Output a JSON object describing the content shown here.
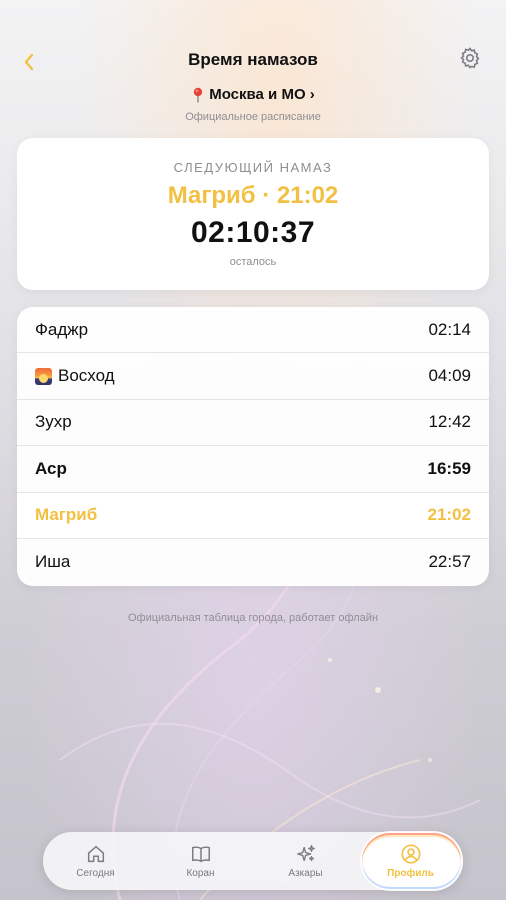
{
  "header": {
    "title": "Время намазов",
    "back_icon": "chevron-left-icon",
    "settings_icon": "gear-icon",
    "city": "Москва и МО ›",
    "subtitle": "Официальное расписание"
  },
  "next_prayer": {
    "label": "СЛЕДУЮЩИЙ НАМАЗ",
    "name_time": "Магриб · 21:02",
    "countdown": "02:10:37",
    "remaining_label": "осталось"
  },
  "prayer_times": [
    {
      "name": "Фаджр",
      "time": "02:14"
    },
    {
      "name": "Восход",
      "time": "04:09"
    },
    {
      "name": "Зухр",
      "time": "12:42"
    },
    {
      "name": "Аср",
      "time": "16:59"
    },
    {
      "name": "Магриб",
      "time": "21:02"
    },
    {
      "name": "Иша",
      "time": "22:57"
    }
  ],
  "footnote": "Официальная таблица города, работает офлайн",
  "tabs": [
    {
      "label": "Сегодня",
      "icon": "home-icon"
    },
    {
      "label": "Коран",
      "icon": "book-icon"
    },
    {
      "label": "Азкары",
      "icon": "sparkles-icon"
    },
    {
      "label": "Профиль",
      "icon": "profile-icon"
    }
  ],
  "colors": {
    "accent": "#f2c043",
    "text": "#111111",
    "muted": "#8e8e93"
  }
}
